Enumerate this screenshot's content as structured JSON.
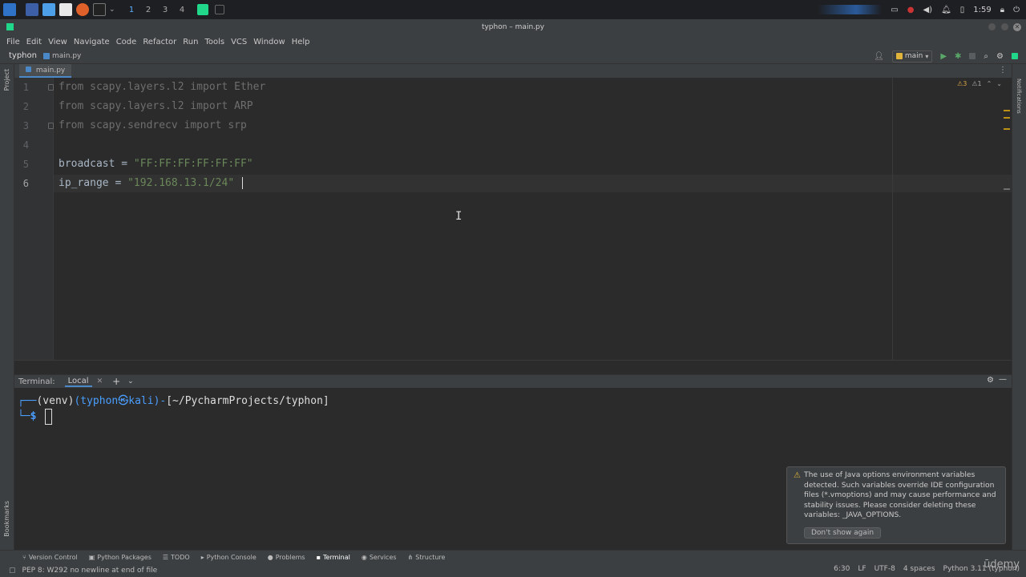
{
  "taskbar": {
    "workspaces": [
      "1",
      "2",
      "3",
      "4"
    ],
    "clock": "1:59"
  },
  "window": {
    "title": "typhon – main.py"
  },
  "menu": [
    "File",
    "Edit",
    "View",
    "Navigate",
    "Code",
    "Refactor",
    "Run",
    "Tools",
    "VCS",
    "Window",
    "Help"
  ],
  "navbar": {
    "project": "typhon",
    "file": "main.py",
    "run_config": "main"
  },
  "editor": {
    "tab": "main.py",
    "inspections": {
      "warnings": "3",
      "weak": "1"
    },
    "line_numbers": [
      "1",
      "2",
      "3",
      "4",
      "5",
      "6"
    ],
    "code": {
      "l1": "from scapy.layers.l2 import Ether",
      "l2": "from scapy.layers.l2 import ARP",
      "l3": "from scapy.sendrecv import srp",
      "l5_var": "broadcast = ",
      "l5_str": "\"FF:FF:FF:FF:FF:FF\"",
      "l6_var": "ip_range = ",
      "l6_str": "\"192.168.13.1/24\""
    }
  },
  "terminal": {
    "header_label": "Terminal:",
    "tab": "Local",
    "prompt_venv": "(venv)",
    "prompt_user": "(typhon",
    "prompt_at": "㉿",
    "prompt_host": "kali)",
    "prompt_path": "[~/PycharmProjects/typhon]",
    "prompt_prefix": "┌──",
    "prompt_dash": "-",
    "prompt_line2": "└─",
    "prompt_symbol": "$"
  },
  "notification": {
    "text": "The use of Java options environment variables detected. Such variables override IDE configuration files (*.vmoptions) and may cause performance and stability issues. Please consider deleting these variables: _JAVA_OPTIONS.",
    "button": "Don't show again"
  },
  "tool_windows": [
    "Version Control",
    "Python Packages",
    "TODO",
    "Python Console",
    "Problems",
    "Terminal",
    "Services",
    "Structure"
  ],
  "side_tools": {
    "left_top": "Project",
    "left_bottom": "Bookmarks",
    "right": "Notifications"
  },
  "status": {
    "message": "PEP 8: W292 no newline at end of file",
    "position": "6:30",
    "line_sep": "LF",
    "encoding": "UTF-8",
    "indent": "4 spaces",
    "interpreter": "Python 3.11 (typhon)"
  },
  "watermark": "ūdemy",
  "colors": {
    "accent": "#4a88c7",
    "string": "#6a8759",
    "prompt_blue": "#4a9eff",
    "prompt_green": "#8ac05b"
  }
}
